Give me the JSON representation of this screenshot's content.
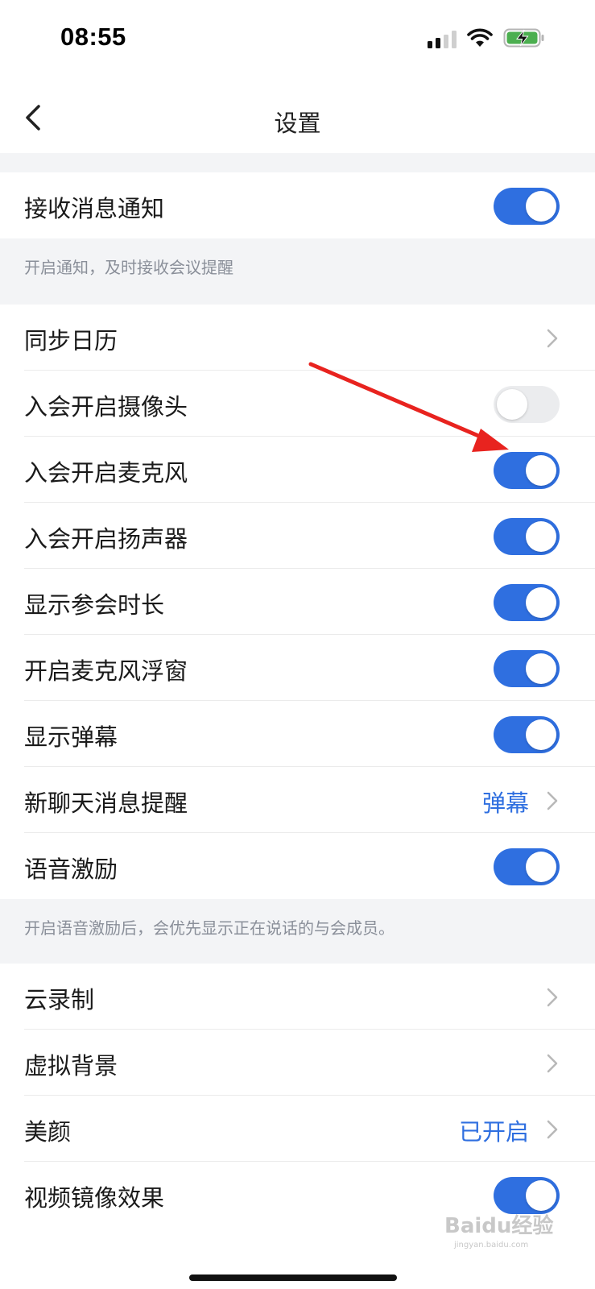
{
  "status_bar": {
    "time": "08:55",
    "icons": [
      "cellular-signal-icon",
      "wifi-icon",
      "battery-charging-icon"
    ],
    "battery_color": "#4caf50"
  },
  "nav": {
    "title": "设置",
    "back_icon": "chevron-left-icon"
  },
  "accent_color": "#2f6fe0",
  "groups": [
    {
      "rows": [
        {
          "label": "接收消息通知",
          "type": "toggle",
          "on": true
        }
      ],
      "note": "开启通知，及时接收会议提醒"
    },
    {
      "rows": [
        {
          "label": "同步日历",
          "type": "link"
        },
        {
          "label": "入会开启摄像头",
          "type": "toggle",
          "on": false
        },
        {
          "label": "入会开启麦克风",
          "type": "toggle",
          "on": true
        },
        {
          "label": "入会开启扬声器",
          "type": "toggle",
          "on": true
        },
        {
          "label": "显示参会时长",
          "type": "toggle",
          "on": true
        },
        {
          "label": "开启麦克风浮窗",
          "type": "toggle",
          "on": true
        },
        {
          "label": "显示弹幕",
          "type": "toggle",
          "on": true
        },
        {
          "label": "新聊天消息提醒",
          "type": "link",
          "value": "弹幕"
        },
        {
          "label": "语音激励",
          "type": "toggle",
          "on": true
        }
      ],
      "note": "开启语音激励后，会优先显示正在说话的与会成员。"
    },
    {
      "rows": [
        {
          "label": "云录制",
          "type": "link"
        },
        {
          "label": "虚拟背景",
          "type": "link"
        },
        {
          "label": "美颜",
          "type": "link",
          "value": "已开启"
        },
        {
          "label": "视频镜像效果",
          "type": "toggle",
          "on": true
        }
      ]
    }
  ],
  "annotation": {
    "type": "red-arrow",
    "color": "#e8231f",
    "points_to": "入会开启麦克风"
  },
  "watermark": {
    "text": "Baidu经验",
    "sub": "jingyan.baidu.com"
  }
}
